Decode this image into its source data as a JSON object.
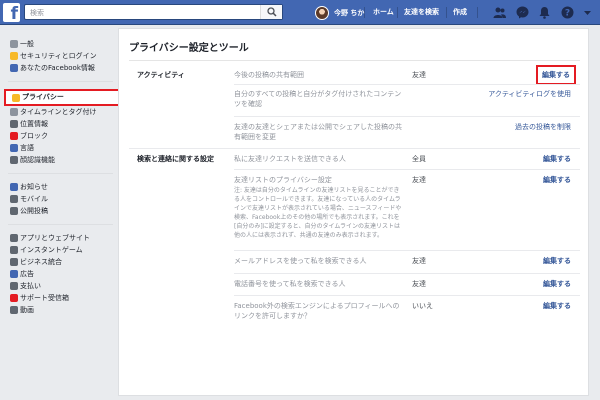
{
  "topbar": {
    "logo": "f",
    "search_placeholder": "検索",
    "user_name": "今野 ちか",
    "nav": [
      "ホーム",
      "友達を検索",
      "作成"
    ],
    "icons": [
      "friends-icon",
      "messenger-icon",
      "notifications-icon",
      "help-icon"
    ]
  },
  "sidebar": {
    "groups": [
      [
        {
          "label": "一般",
          "icon": "gear-icon",
          "color": "#8d949e"
        },
        {
          "label": "セキュリティとログイン",
          "icon": "shield-icon",
          "color": "#f7b928"
        },
        {
          "label": "あなたのFacebook情報",
          "icon": "facebook-icon",
          "color": "#4267b2"
        }
      ],
      [
        {
          "label": "プライバシー",
          "icon": "lock-icon",
          "color": "#f7b928",
          "active": true
        },
        {
          "label": "タイムラインとタグ付け",
          "icon": "timeline-icon",
          "color": "#8d949e"
        },
        {
          "label": "位置情報",
          "icon": "location-icon",
          "color": "#606770"
        },
        {
          "label": "ブロック",
          "icon": "block-icon",
          "color": "#e41b22"
        },
        {
          "label": "言語",
          "icon": "language-icon",
          "color": "#4267b2"
        },
        {
          "label": "顔認識機能",
          "icon": "face-icon",
          "color": "#606770"
        }
      ],
      [
        {
          "label": "お知らせ",
          "icon": "globe-icon",
          "color": "#4267b2"
        },
        {
          "label": "モバイル",
          "icon": "mobile-icon",
          "color": "#606770"
        },
        {
          "label": "公開投稿",
          "icon": "rss-icon",
          "color": "#606770"
        }
      ],
      [
        {
          "label": "アプリとウェブサイト",
          "icon": "apps-icon",
          "color": "#606770"
        },
        {
          "label": "インスタントゲーム",
          "icon": "game-icon",
          "color": "#606770"
        },
        {
          "label": "ビジネス統合",
          "icon": "business-icon",
          "color": "#606770"
        },
        {
          "label": "広告",
          "icon": "ads-icon",
          "color": "#4267b2"
        },
        {
          "label": "支払い",
          "icon": "payment-icon",
          "color": "#606770"
        },
        {
          "label": "サポート受信箱",
          "icon": "support-icon",
          "color": "#e41b22"
        },
        {
          "label": "動画",
          "icon": "video-icon",
          "color": "#606770"
        }
      ]
    ]
  },
  "main": {
    "title": "プライバシー設定とツール",
    "sections": [
      {
        "title": "アクティビティ",
        "rows": [
          {
            "q": "今後の投稿の共有範囲",
            "val": "友達",
            "action": "編集する",
            "style": "boxed"
          },
          {
            "q": "自分のすべての投稿と自分がタグ付けされたコンテンツを確認",
            "val": "",
            "action": "アクティビティログを使用",
            "style": "plain"
          },
          {
            "q": "友達の友達とシェアまたは公開でシェアした投稿の共有範囲を変更",
            "val": "",
            "action": "過去の投稿を制限",
            "style": "plain"
          }
        ]
      },
      {
        "title": "検索と連絡に関する設定",
        "rows": [
          {
            "q": "私に友達リクエストを送信できる人",
            "val": "全員",
            "action": "編集する",
            "style": "bold"
          },
          {
            "q": "友達リストのプライバシー設定",
            "note": "注: 友達は自分のタイムラインの友達リストを見ることができる人をコントロールできます。友達になっている人のタイムラインで友達リストが表示されている場合、ニュースフィードや検索、Facebook上のその他の場所でも表示されます。これを[自分のみ]に設定すると、自分のタイムラインの友達リストは他の人には表示されず、共通の友達のみ表示されます。",
            "val": "友達",
            "action": "編集する",
            "style": "bold"
          },
          {
            "q": "メールアドレスを使って私を検索できる人",
            "val": "友達",
            "action": "編集する",
            "style": "bold"
          },
          {
            "q": "電話番号を使って私を検索できる人",
            "val": "友達",
            "action": "編集する",
            "style": "bold"
          },
          {
            "q": "Facebook外の検索エンジンによるプロフィールへのリンクを許可しますか？",
            "val": "いいえ",
            "action": "編集する",
            "style": "bold"
          }
        ]
      }
    ]
  }
}
